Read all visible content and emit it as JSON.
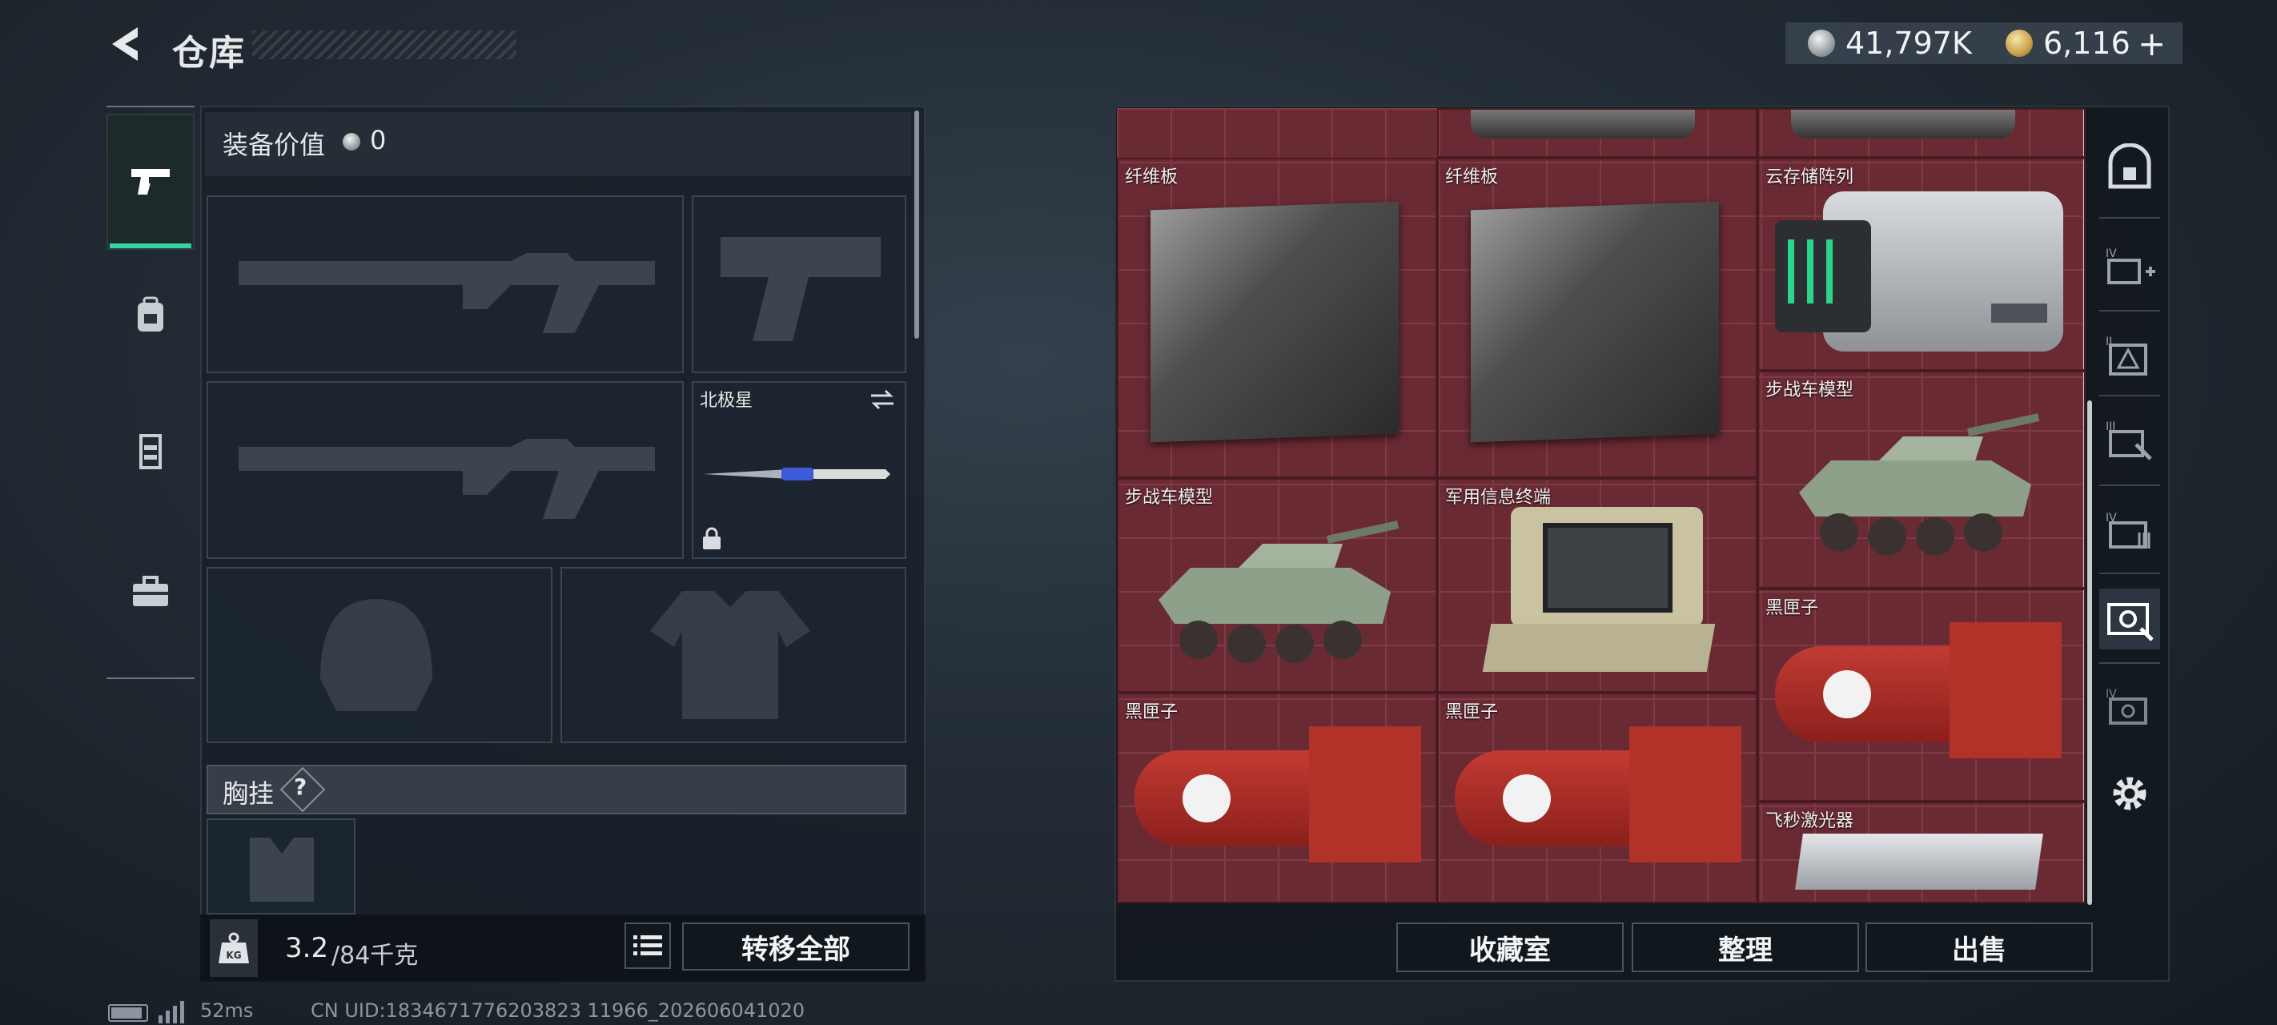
{
  "header": {
    "title": "仓库",
    "currencies": [
      {
        "icon": "silver-coin-icon",
        "value": "41,797K"
      },
      {
        "icon": "gold-coin-icon",
        "value": "6,116"
      }
    ],
    "add_label": "+"
  },
  "sidebar": {
    "tabs": [
      {
        "icon": "pistol-icon",
        "active": true
      },
      {
        "icon": "backpack-icon",
        "active": false
      },
      {
        "icon": "vest-icon",
        "active": false
      },
      {
        "icon": "toolbox-icon",
        "active": false
      }
    ]
  },
  "equipment": {
    "value_label": "装备价值",
    "value": "0",
    "melee_name": "北极星",
    "chest_rig_label": "胸挂",
    "help_label": "?",
    "weight": "3.2",
    "weight_max": "/84千克",
    "transfer_all": "转移全部"
  },
  "storage": {
    "items": [
      {
        "name": "纤维板",
        "type": "fiberboard"
      },
      {
        "name": "纤维板",
        "type": "fiberboard"
      },
      {
        "name": "云存储阵列",
        "type": "server"
      },
      {
        "name": "步战车模型",
        "type": "ifv"
      },
      {
        "name": "步战车模型",
        "type": "ifv"
      },
      {
        "name": "军用信息终端",
        "type": "terminal"
      },
      {
        "name": "黑匣子",
        "type": "blackbox"
      },
      {
        "name": "黑匣子",
        "type": "blackbox"
      },
      {
        "name": "黑匣子",
        "type": "blackbox"
      },
      {
        "name": "飞秒激光器",
        "type": "laser"
      }
    ],
    "buttons": {
      "collection": "收藏室",
      "sort": "整理",
      "sell": "出售"
    },
    "rail_icons": [
      "safe-icon",
      "tier4-add-icon",
      "tier2-warning-icon",
      "tier3-tool-icon",
      "tier4-barcode-icon",
      "tier-scan-icon",
      "tier4-scan-icon",
      "settings-gear-icon"
    ]
  },
  "status": {
    "ping": "52ms",
    "uid": "CN UID:1834671776203823 11966_202606041020"
  }
}
